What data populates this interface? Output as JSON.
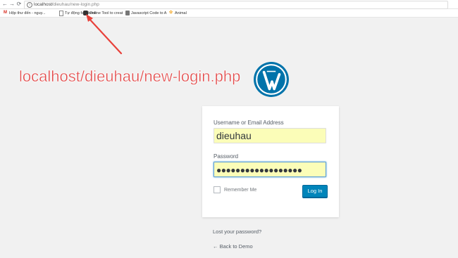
{
  "browser": {
    "nav": {
      "back": "←",
      "forward": "→",
      "reload": "⟳"
    },
    "url_host": "localhost/",
    "url_path": "dieuhau/new-login.php",
    "bookmarks": [
      {
        "label": "Hộp thư đến - nguy...",
        "icon": "gmail-icon"
      },
      {
        "label": "Tự động facebook",
        "icon": "page-icon"
      },
      {
        "label": "Online Tool to creat",
        "icon": "bug-icon"
      },
      {
        "label": "Javascript Code to A",
        "icon": "doc-icon"
      },
      {
        "label": "Animal",
        "icon": "animal-icon"
      }
    ]
  },
  "annotation": {
    "text": "localhost/dieuhau/new-login.php",
    "color": "#e24a4a"
  },
  "login": {
    "username_label": "Username or Email Address",
    "username_value": "dieuhau",
    "password_label": "Password",
    "password_value": "●●●●●●●●●●●●●●●●●●",
    "remember_label": "Remember Me",
    "submit_label": "Log In",
    "accent_color": "#0085ba",
    "autofill_color": "#fbfdb8"
  },
  "links": {
    "lost_password": "Lost your password?",
    "back_to_site": "← Back to Demo"
  }
}
